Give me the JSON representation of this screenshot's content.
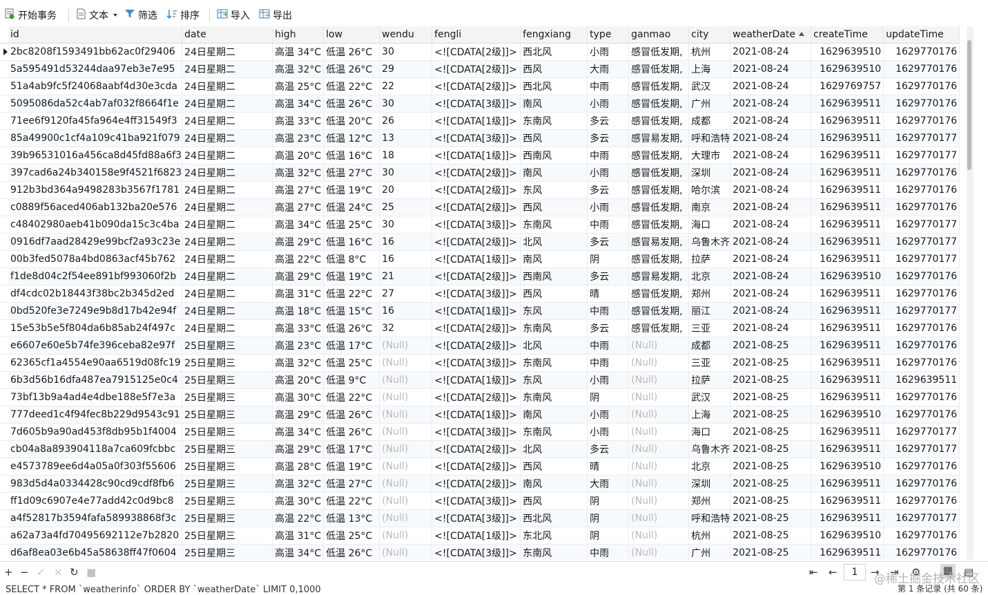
{
  "toolbar": {
    "begin_tx": "开始事务",
    "text": "文本",
    "filter": "筛选",
    "sort": "排序",
    "import": "导入",
    "export": "导出"
  },
  "columns": [
    "id",
    "date",
    "high",
    "low",
    "wendu",
    "fengli",
    "fengxiang",
    "type",
    "ganmao",
    "city",
    "weatherDate",
    "createTime",
    "updateTime"
  ],
  "sort_column": "weatherDate",
  "rows": [
    [
      "2bc8208f1593491bb62ac0f29406",
      "24日星期二",
      "高温 34°C",
      "低温 26°C",
      "30",
      "<![CDATA[2级]]>",
      "西北风",
      "小雨",
      "感冒低发期,",
      "杭州",
      "2021-08-24",
      "1629639510",
      "1629770176"
    ],
    [
      "5a595491d53244daa97eb3e7e95",
      "24日星期二",
      "高温 32°C",
      "低温 26°C",
      "29",
      "<![CDATA[2级]]>",
      "西风",
      "大雨",
      "感冒低发期,",
      "上海",
      "2021-08-24",
      "1629639510",
      "1629770176"
    ],
    [
      "51a4ab9fc5f24068aabf4d30e3cda",
      "24日星期二",
      "高温 25°C",
      "低温 22°C",
      "22",
      "<![CDATA[2级]]>",
      "西北风",
      "中雨",
      "感冒低发期,",
      "武汉",
      "2021-08-24",
      "1629769757",
      "1629770176"
    ],
    [
      "5095086da52c4ab7af032f8664f1e",
      "24日星期二",
      "高温 34°C",
      "低温 26°C",
      "30",
      "<![CDATA[3级]]>",
      "南风",
      "小雨",
      "感冒低发期,",
      "广州",
      "2021-08-24",
      "1629639511",
      "1629770176"
    ],
    [
      "71ee6f9120fa45fa964e4ff31549f3",
      "24日星期二",
      "高温 33°C",
      "低温 20°C",
      "26",
      "<![CDATA[1级]]>",
      "东南风",
      "多云",
      "感冒低发期,",
      "成都",
      "2021-08-24",
      "1629639511",
      "1629770176"
    ],
    [
      "85a49900c1cf4a109c41ba921f079",
      "24日星期二",
      "高温 23°C",
      "低温 12°C",
      "13",
      "<![CDATA[3级]]>",
      "西风",
      "多云",
      "感冒易发期,",
      "呼和浩特",
      "2021-08-24",
      "1629639511",
      "1629770177"
    ],
    [
      "39b96531016a456ca8d45fd88a6f3",
      "24日星期二",
      "高温 20°C",
      "低温 16°C",
      "18",
      "<![CDATA[1级]]>",
      "西南风",
      "中雨",
      "感冒低发期,",
      "大理市",
      "2021-08-24",
      "1629639511",
      "1629770177"
    ],
    [
      "397cad6a24b340158e9f4521f6823",
      "24日星期二",
      "高温 32°C",
      "低温 27°C",
      "30",
      "<![CDATA[2级]]>",
      "南风",
      "小雨",
      "感冒低发期,",
      "深圳",
      "2021-08-24",
      "1629639511",
      "1629770176"
    ],
    [
      "912b3bd364a9498283b3567f1781",
      "24日星期二",
      "高温 27°C",
      "低温 19°C",
      "20",
      "<![CDATA[2级]]>",
      "东风",
      "多云",
      "感冒低发期,",
      "哈尔滨",
      "2021-08-24",
      "1629639511",
      "1629770176"
    ],
    [
      "c0889f56aced406ab132ba20e576",
      "24日星期二",
      "高温 27°C",
      "低温 24°C",
      "25",
      "<![CDATA[2级]]>",
      "西风",
      "小雨",
      "感冒低发期,",
      "南京",
      "2021-08-24",
      "1629639511",
      "1629770176"
    ],
    [
      "c48402980aeb41b090da15c3c4ba",
      "24日星期二",
      "高温 34°C",
      "低温 25°C",
      "30",
      "<![CDATA[3级]]>",
      "东南风",
      "中雨",
      "感冒低发期,",
      "海口",
      "2021-08-24",
      "1629639511",
      "1629770177"
    ],
    [
      "0916df7aad28429e99bcf2a93c23e",
      "24日星期二",
      "高温 29°C",
      "低温 16°C",
      "16",
      "<![CDATA[2级]]>",
      "北风",
      "多云",
      "感冒易发期,",
      "乌鲁木齐",
      "2021-08-24",
      "1629639511",
      "1629770177"
    ],
    [
      "00b3fed5078a4bd0863acf45b762",
      "24日星期二",
      "高温 22°C",
      "低温 8°C",
      "16",
      "<![CDATA[1级]]>",
      "南风",
      "阴",
      "感冒低发期,",
      "拉萨",
      "2021-08-24",
      "1629639511",
      "1629770177"
    ],
    [
      "f1de8d04c2f54ee891bf993060f2b",
      "24日星期二",
      "高温 29°C",
      "低温 19°C",
      "21",
      "<![CDATA[2级]]>",
      "西南风",
      "多云",
      "感冒易发期,",
      "北京",
      "2021-08-24",
      "1629639510",
      "1629770176"
    ],
    [
      "df4cdc02b18443f38bc2b345d2ed",
      "24日星期二",
      "高温 31°C",
      "低温 22°C",
      "27",
      "<![CDATA[3级]]>",
      "西风",
      "晴",
      "感冒低发期,",
      "郑州",
      "2021-08-24",
      "1629639511",
      "1629770176"
    ],
    [
      "0bd520fe3e7249e9b8d17b42e94f",
      "24日星期二",
      "高温 18°C",
      "低温 15°C",
      "16",
      "<![CDATA[1级]]>",
      "东风",
      "中雨",
      "感冒低发期,",
      "丽江",
      "2021-08-24",
      "1629639511",
      "1629770177"
    ],
    [
      "15e53b5e5f804da6b85ab24f497c",
      "24日星期二",
      "高温 33°C",
      "低温 26°C",
      "32",
      "<![CDATA[2级]]>",
      "东南风",
      "多云",
      "感冒低发期,",
      "三亚",
      "2021-08-24",
      "1629639511",
      "1629770176"
    ],
    [
      "e6607e60e5b74fe396ceba82e97f",
      "25日星期三",
      "高温 23°C",
      "低温 17°C",
      "(Null)",
      "<![CDATA[2级]]>",
      "北风",
      "中雨",
      "(Null)",
      "成都",
      "2021-08-25",
      "1629639511",
      "1629770176"
    ],
    [
      "62365cf1a4554e90aa6519d08fc19",
      "25日星期三",
      "高温 32°C",
      "低温 25°C",
      "(Null)",
      "<![CDATA[3级]]>",
      "东南风",
      "中雨",
      "(Null)",
      "三亚",
      "2021-08-25",
      "1629639511",
      "1629770176"
    ],
    [
      "6b3d56b16dfa487ea7915125e0c4",
      "25日星期三",
      "高温 20°C",
      "低温 9°C",
      "(Null)",
      "<![CDATA[1级]]>",
      "东风",
      "小雨",
      "(Null)",
      "拉萨",
      "2021-08-25",
      "1629639511",
      "1629639511"
    ],
    [
      "73bf13b9a4ad4e4dbe188e5f7e3a",
      "25日星期三",
      "高温 30°C",
      "低温 22°C",
      "(Null)",
      "<![CDATA[2级]]>",
      "东南风",
      "阴",
      "(Null)",
      "武汉",
      "2021-08-25",
      "1629639511",
      "1629770176"
    ],
    [
      "777deed1c4f94fec8b229d9543c91",
      "25日星期三",
      "高温 29°C",
      "低温 26°C",
      "(Null)",
      "<![CDATA[1级]]>",
      "南风",
      "小雨",
      "(Null)",
      "上海",
      "2021-08-25",
      "1629639510",
      "1629770176"
    ],
    [
      "7d605b9a90ad453f8db95b1f4004",
      "25日星期三",
      "高温 34°C",
      "低温 26°C",
      "(Null)",
      "<![CDATA[3级]]>",
      "东南风",
      "小雨",
      "(Null)",
      "海口",
      "2021-08-25",
      "1629639511",
      "1629770177"
    ],
    [
      "cb04a8a893904118a7ca609fcbbc",
      "25日星期三",
      "高温 29°C",
      "低温 17°C",
      "(Null)",
      "<![CDATA[2级]]>",
      "北风",
      "多云",
      "(Null)",
      "乌鲁木齐",
      "2021-08-25",
      "1629639511",
      "1629770177"
    ],
    [
      "e4573789ee6d4a05a0f303f55606",
      "25日星期三",
      "高温 28°C",
      "低温 19°C",
      "(Null)",
      "<![CDATA[2级]]>",
      "西风",
      "晴",
      "(Null)",
      "北京",
      "2021-08-25",
      "1629639510",
      "1629770176"
    ],
    [
      "983d5d4a0334428c90cd9cdf8fb6",
      "25日星期三",
      "高温 32°C",
      "低温 27°C",
      "(Null)",
      "<![CDATA[2级]]>",
      "南风",
      "大雨",
      "(Null)",
      "深圳",
      "2021-08-25",
      "1629639511",
      "1629770176"
    ],
    [
      "ff1d09c6907e4e77add42c0d9bc8",
      "25日星期三",
      "高温 30°C",
      "低温 22°C",
      "(Null)",
      "<![CDATA[3级]]>",
      "西风",
      "阴",
      "(Null)",
      "郑州",
      "2021-08-25",
      "1629639511",
      "1629770176"
    ],
    [
      "a4f52817b3594fafa589938868f3c",
      "25日星期三",
      "高温 22°C",
      "低温 13°C",
      "(Null)",
      "<![CDATA[3级]]>",
      "西北风",
      "阴",
      "(Null)",
      "呼和浩特",
      "2021-08-25",
      "1629639511",
      "1629770177"
    ],
    [
      "a62a73a4fd70495692112e7b2820",
      "25日星期三",
      "高温 31°C",
      "低温 25°C",
      "(Null)",
      "<![CDATA[1级]]>",
      "东北风",
      "阴",
      "(Null)",
      "杭州",
      "2021-08-25",
      "1629639510",
      "1629770176"
    ],
    [
      "d6af8ea03e6b45a58638ff47f0604",
      "25日星期三",
      "高温 34°C",
      "低温 26°C",
      "(Null)",
      "<![CDATA[3级]]>",
      "东南风",
      "中雨",
      "(Null)",
      "广州",
      "2021-08-25",
      "1629639511",
      "1629770176"
    ]
  ],
  "pager": {
    "page": "1"
  },
  "status": {
    "sql": "SELECT * FROM `weatherinfo` ORDER BY `weatherDate` LIMIT 0,1000",
    "records": "第 1 条记录 (共 60 条)"
  },
  "watermark": "@稀土掘金技术社区"
}
